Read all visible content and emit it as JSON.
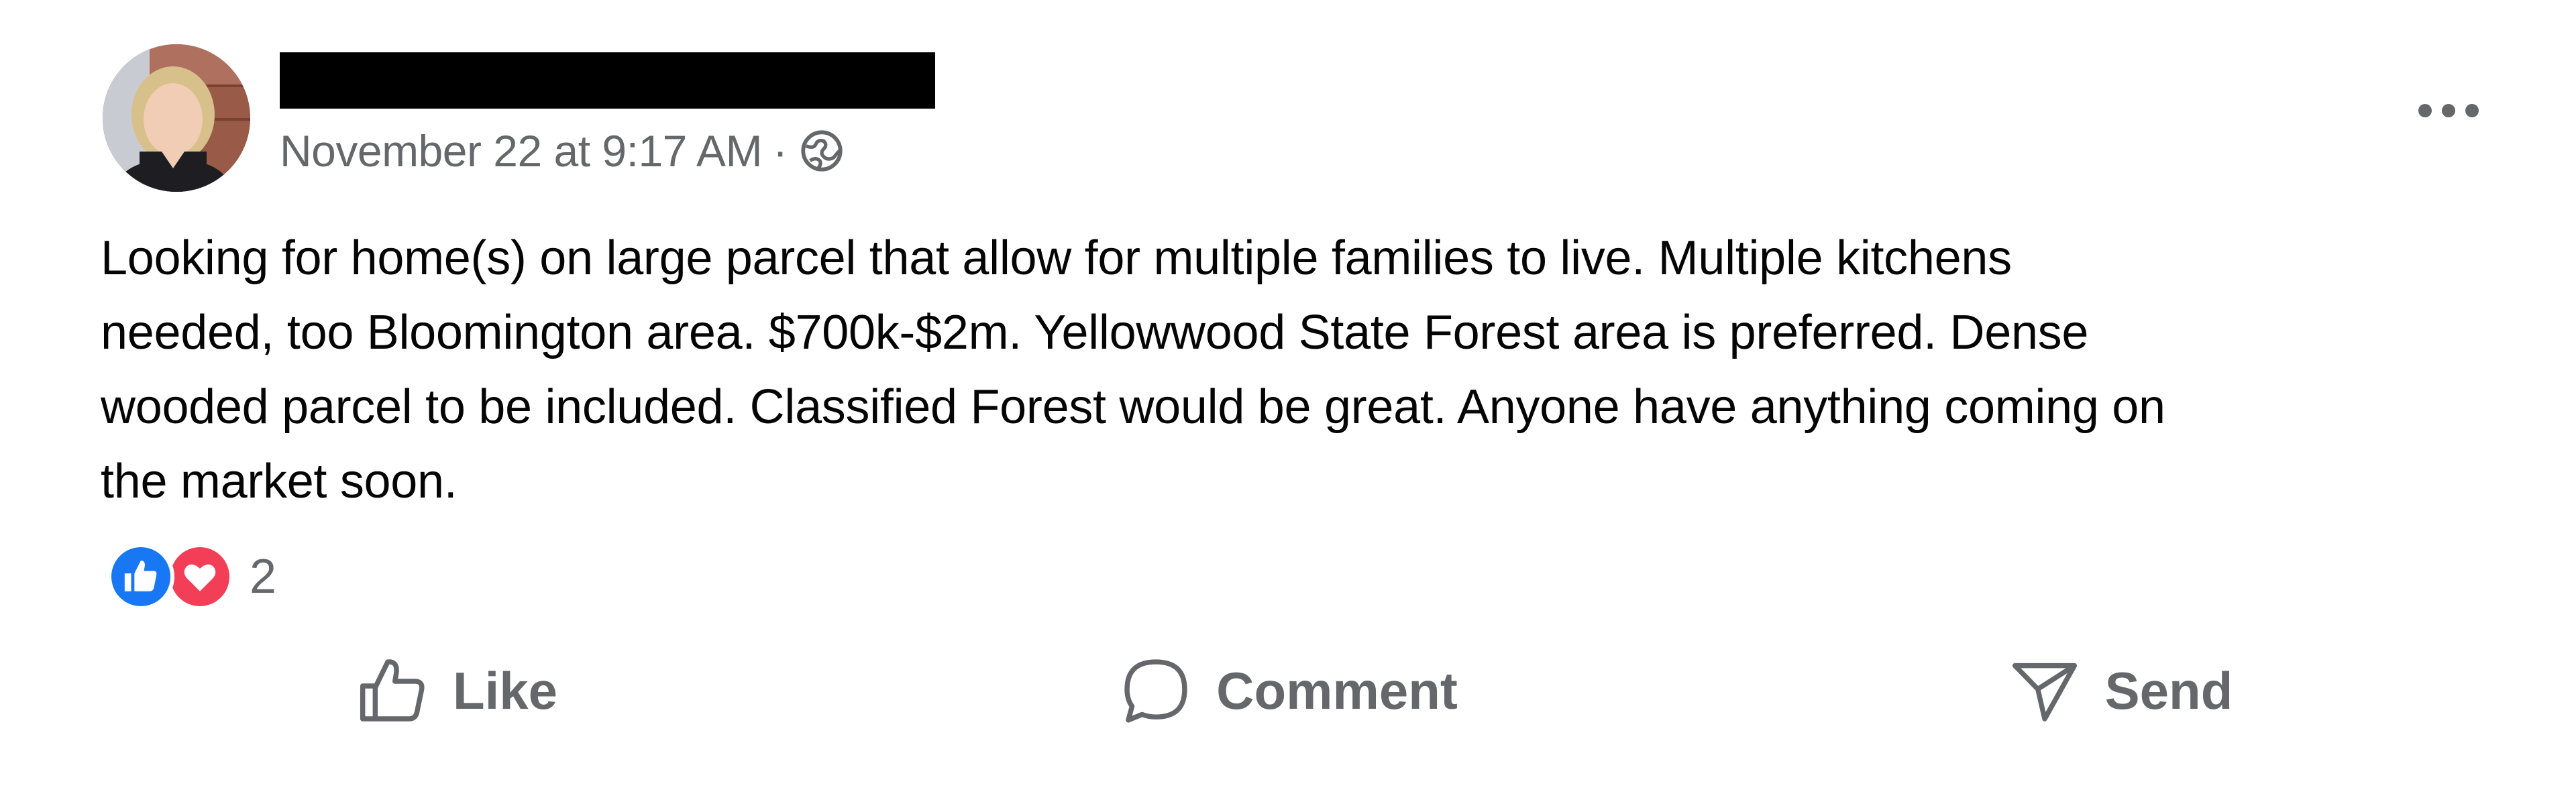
{
  "post": {
    "timestamp": "November 22 at 9:17 AM",
    "separator": "·",
    "audience_icon": "globe-icon",
    "more_icon": "more-horizontal-icon",
    "text_lines": [
      "Looking for home(s) on large parcel that allow for multiple families to live. Multiple kitchens",
      "needed, too Bloomington area. $700k-$2m. Yellowwood State Forest area is preferred. Dense",
      "wooded parcel to be included. Classified Forest would be great. Anyone have anything coming on",
      "the market soon."
    ],
    "reactions": {
      "types": [
        "like",
        "love"
      ],
      "count": "2"
    }
  },
  "actions": {
    "like_label": "Like",
    "comment_label": "Comment",
    "send_label": "Send"
  },
  "colors": {
    "text": "#050505",
    "secondary_text": "#65676b",
    "like_blue": "#1877f2",
    "love_red": "#f33e58"
  }
}
